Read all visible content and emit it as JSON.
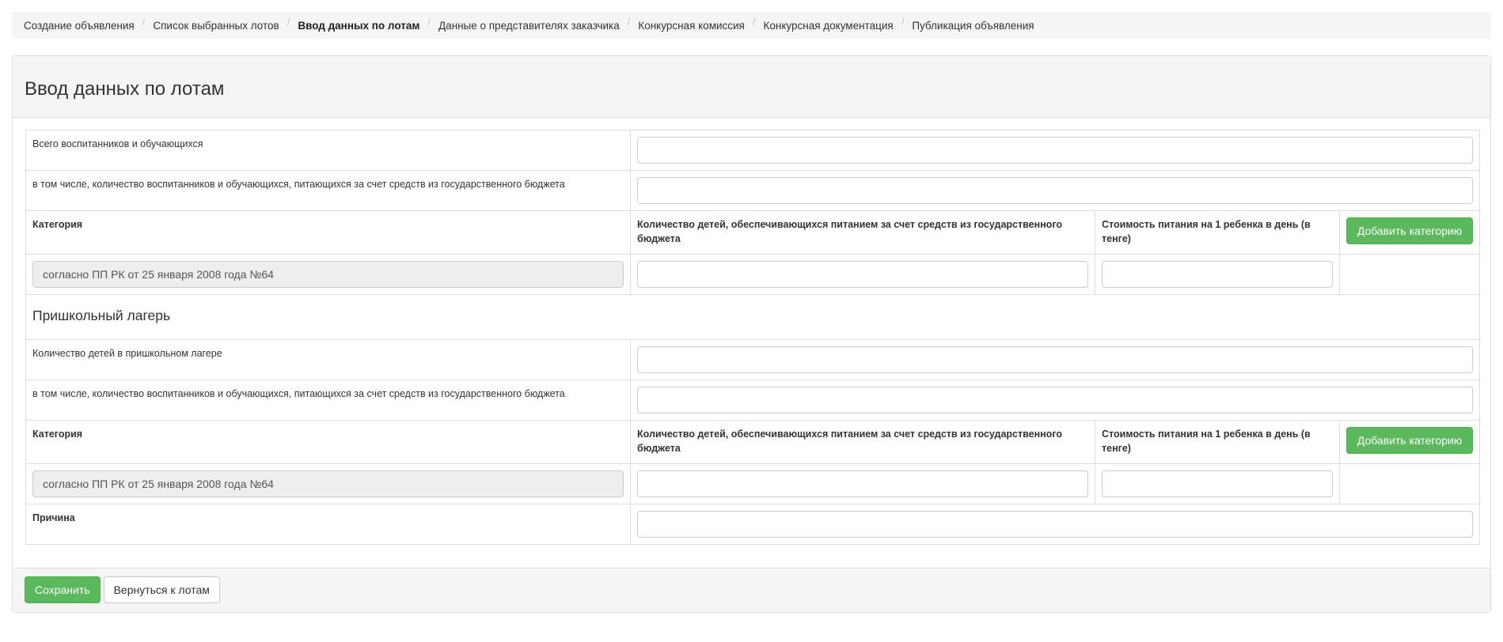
{
  "breadcrumb": [
    {
      "label": "Создание объявления",
      "active": false
    },
    {
      "label": "Список выбранных лотов",
      "active": false
    },
    {
      "label": "Ввод данных по лотам",
      "active": true
    },
    {
      "label": "Данные о представителях заказчика",
      "active": false
    },
    {
      "label": "Конкурсная комиссия",
      "active": false
    },
    {
      "label": "Конкурсная документация",
      "active": false
    },
    {
      "label": "Публикация объявления",
      "active": false
    }
  ],
  "panel": {
    "title": "Ввод данных по лотам"
  },
  "school": {
    "total_label": "Всего воспитанников и обучающихся",
    "total_value": "",
    "budget_label": "в том числе, количество воспитанников и обучающихся, питающихся за счет средств из государственного бюджета",
    "budget_value": "",
    "header": {
      "category": "Категория",
      "children_count": "Количество детей, обеспечивающихся питанием за счет средств из государственного бюджета",
      "cost": "Стоимость питания на 1 ребенка в день (в тенге)",
      "add_button": "Добавить категорию"
    },
    "row": {
      "category_value": "согласно ПП РК от 25 января 2008 года №64",
      "children_value": "",
      "cost_value": ""
    }
  },
  "camp": {
    "title": "Пришкольный лагерь",
    "count_label": "Количество детей в пришкольном лагере",
    "count_value": "",
    "budget_label": "в том числе, количество воспитанников и обучающихся, питающихся за счет средств из государственного бюджета",
    "budget_value": "",
    "header": {
      "category": "Категория",
      "children_count": "Количество детей, обеспечивающихся питанием за счет средств из государственного бюджета",
      "cost": "Стоимость питания на 1 ребенка в день (в тенге)",
      "add_button": "Добавить категорию"
    },
    "row": {
      "category_value": "согласно ПП РК от 25 января 2008 года №64",
      "children_value": "",
      "cost_value": ""
    }
  },
  "reason": {
    "label": "Причина",
    "value": ""
  },
  "footer": {
    "save_label": "Сохранить",
    "back_label": "Вернуться к лотам"
  },
  "colors": {
    "success": "#5cb85c",
    "panel_bg": "#f5f5f5",
    "border": "#dddddd"
  }
}
